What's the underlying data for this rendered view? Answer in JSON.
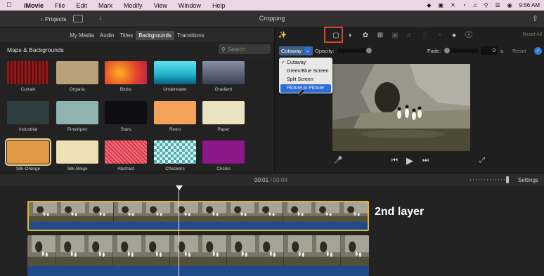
{
  "menubar": {
    "app_name": "iMovie",
    "items": [
      "File",
      "Edit",
      "Mark",
      "Modify",
      "View",
      "Window",
      "Help"
    ],
    "time": "9:56 AM"
  },
  "toolbar": {
    "projects_label": "Projects",
    "window_title": "Cropping"
  },
  "browser_tabs": [
    "My Media",
    "Audio",
    "Titles",
    "Backgrounds",
    "Transitions"
  ],
  "library": {
    "title": "Maps & Backgrounds",
    "search_placeholder": "Search",
    "backgrounds": [
      {
        "label": "Curtain",
        "color": "#8b1a1a"
      },
      {
        "label": "Organic",
        "color": "#b8a27a"
      },
      {
        "label": "Blobs",
        "color": "#e0432d"
      },
      {
        "label": "Underwater",
        "color": "#1fb0c8"
      },
      {
        "label": "Gradient",
        "color": "#3a4052"
      },
      {
        "label": "Industrial",
        "color": "#2c3e3e"
      },
      {
        "label": "Pinstripes",
        "color": "#8fb3b0"
      },
      {
        "label": "Stars",
        "color": "#0d0d12"
      },
      {
        "label": "Retro",
        "color": "#f5a25a"
      },
      {
        "label": "Paper",
        "color": "#e9e4bd"
      },
      {
        "label": "Silk-Orange",
        "color": "#e09a45"
      },
      {
        "label": "Silk-Beige",
        "color": "#ece0b4"
      },
      {
        "label": "Abstract",
        "color": "#d63848"
      },
      {
        "label": "Checkers",
        "color": "#3fb3b5"
      },
      {
        "label": "Circles",
        "color": "#8c1788"
      }
    ]
  },
  "viewer": {
    "reset_all": "Reset All",
    "overlay_select": "Cutaway",
    "opacity_label": "Opacity:",
    "fade_label": "Fade:",
    "fade_value": "0",
    "fade_unit": "s",
    "reset_label": "Reset",
    "overlay_options": [
      "Cutaway",
      "Green/Blue Screen",
      "Split Screen",
      "Picture in Picture"
    ],
    "selected_option": "Cutaway",
    "hovered_option": "Picture in Picture"
  },
  "timeline": {
    "current_time": "00:01",
    "total_time": "00:04",
    "settings_label": "Settings",
    "layer_annotation": "2nd layer"
  },
  "colors": {
    "accent_blue": "#2d6dd6",
    "highlight_red": "#d94535",
    "clip_selected_border": "#e8b820",
    "audio_blue": "#1f4b8a"
  }
}
